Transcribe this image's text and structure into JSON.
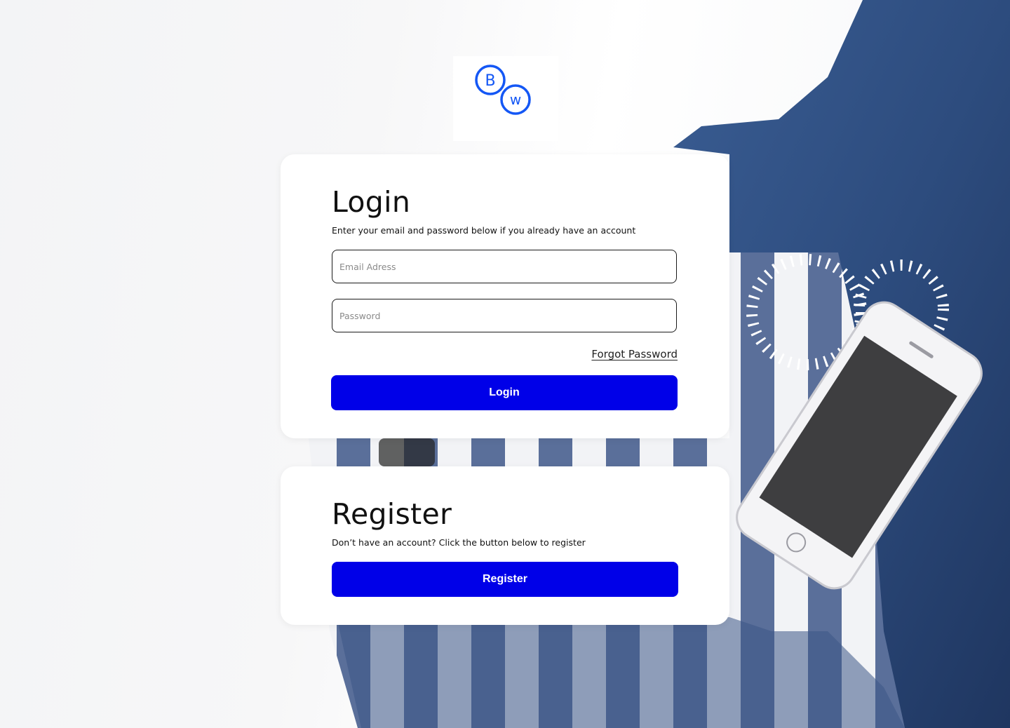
{
  "brand": {
    "logo_letters": [
      "B",
      "W"
    ],
    "accent_color": "#0000e8"
  },
  "login": {
    "title": "Login",
    "subtitle": "Enter your email and password below if you already have an account",
    "email_placeholder": "Email Adress",
    "password_placeholder": "Password",
    "forgot_label": "Forgot Password",
    "submit_label": "Login"
  },
  "register": {
    "title": "Register",
    "subtitle": "Don’t have an account? Click the button below to register",
    "submit_label": "Register"
  }
}
